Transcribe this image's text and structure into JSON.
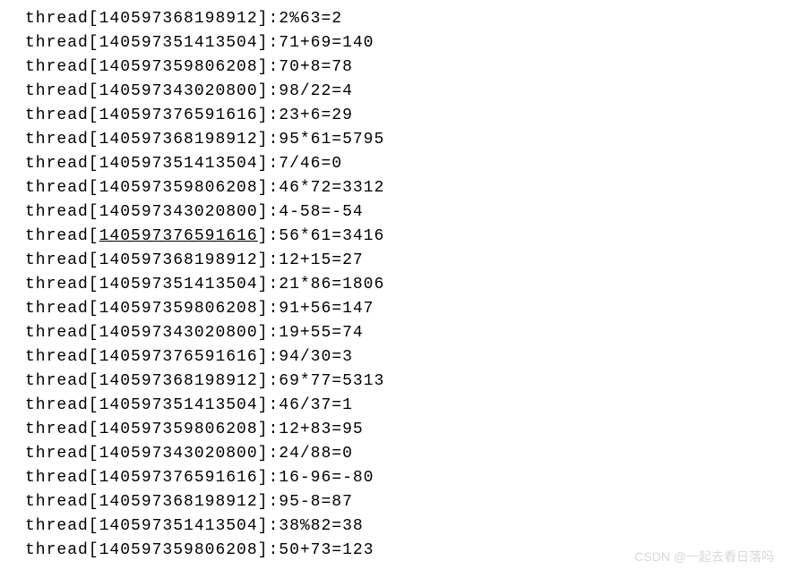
{
  "log_lines": [
    {
      "thread_id": "140597368198912",
      "expr": "2%63=2",
      "underline_id": false
    },
    {
      "thread_id": "140597351413504",
      "expr": "71+69=140",
      "underline_id": false
    },
    {
      "thread_id": "140597359806208",
      "expr": "70+8=78",
      "underline_id": false
    },
    {
      "thread_id": "140597343020800",
      "expr": "98/22=4",
      "underline_id": false
    },
    {
      "thread_id": "140597376591616",
      "expr": "23+6=29",
      "underline_id": false
    },
    {
      "thread_id": "140597368198912",
      "expr": "95*61=5795",
      "underline_id": false
    },
    {
      "thread_id": "140597351413504",
      "expr": "7/46=0",
      "underline_id": false
    },
    {
      "thread_id": "140597359806208",
      "expr": "46*72=3312",
      "underline_id": false
    },
    {
      "thread_id": "140597343020800",
      "expr": "4-58=-54",
      "underline_id": false
    },
    {
      "thread_id": "140597376591616",
      "expr": "56*61=3416",
      "underline_id": true
    },
    {
      "thread_id": "140597368198912",
      "expr": "12+15=27",
      "underline_id": false
    },
    {
      "thread_id": "140597351413504",
      "expr": "21*86=1806",
      "underline_id": false
    },
    {
      "thread_id": "140597359806208",
      "expr": "91+56=147",
      "underline_id": false
    },
    {
      "thread_id": "140597343020800",
      "expr": "19+55=74",
      "underline_id": false
    },
    {
      "thread_id": "140597376591616",
      "expr": "94/30=3",
      "underline_id": false
    },
    {
      "thread_id": "140597368198912",
      "expr": "69*77=5313",
      "underline_id": false
    },
    {
      "thread_id": "140597351413504",
      "expr": "46/37=1",
      "underline_id": false
    },
    {
      "thread_id": "140597359806208",
      "expr": "12+83=95",
      "underline_id": false
    },
    {
      "thread_id": "140597343020800",
      "expr": "24/88=0",
      "underline_id": false
    },
    {
      "thread_id": "140597376591616",
      "expr": "16-96=-80",
      "underline_id": false
    },
    {
      "thread_id": "140597368198912",
      "expr": "95-8=87",
      "underline_id": false
    },
    {
      "thread_id": "140597351413504",
      "expr": "38%82=38",
      "underline_id": false
    },
    {
      "thread_id": "140597359806208",
      "expr": "50+73=123",
      "underline_id": false
    }
  ],
  "watermark": "CSDN @一起去看日落吗"
}
